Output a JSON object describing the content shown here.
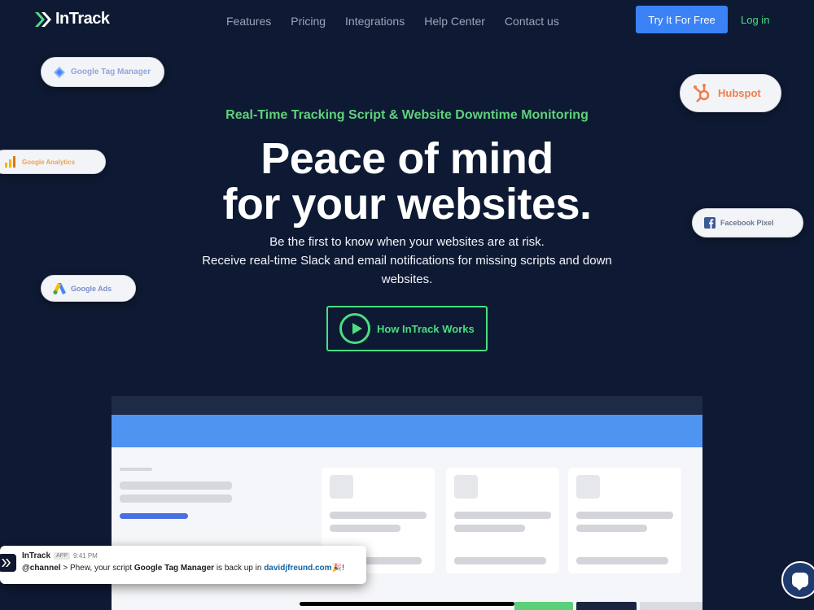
{
  "brand": {
    "name": "InTrack"
  },
  "nav": {
    "items": [
      "Features",
      "Pricing",
      "Integrations",
      "Help Center",
      "Contact us"
    ],
    "cta_label": "Try It For Free",
    "login_label": "Log in"
  },
  "integrations": {
    "gtm": "Google Tag Manager",
    "ga": "Google Analytics",
    "gads": "Google Ads",
    "hubspot": "Hubspot",
    "facebook": "Facebook Pixel"
  },
  "hero": {
    "tagline": "Real-Time Tracking Script & Website Downtime Monitoring",
    "headline_line1": "Peace of mind",
    "headline_line2": "for your websites.",
    "sub_line1": "Be the first to know when your websites are at risk.",
    "sub_line2": "Receive real-time Slack and email notifications for missing scripts and down websites.",
    "video_button": "How InTrack Works"
  },
  "notification": {
    "app": "InTrack",
    "tag": "APP",
    "time": "9:41 PM",
    "channel": "@channel",
    "text_before": " > Phew, your script ",
    "script_name": "Google Tag Manager",
    "text_middle": " is back up in ",
    "site": "davidjfreund.com",
    "emoji": "🎉!"
  },
  "colors": {
    "background": "#0e1a33",
    "accent_green": "#4ade80",
    "accent_blue": "#3b82f6"
  }
}
